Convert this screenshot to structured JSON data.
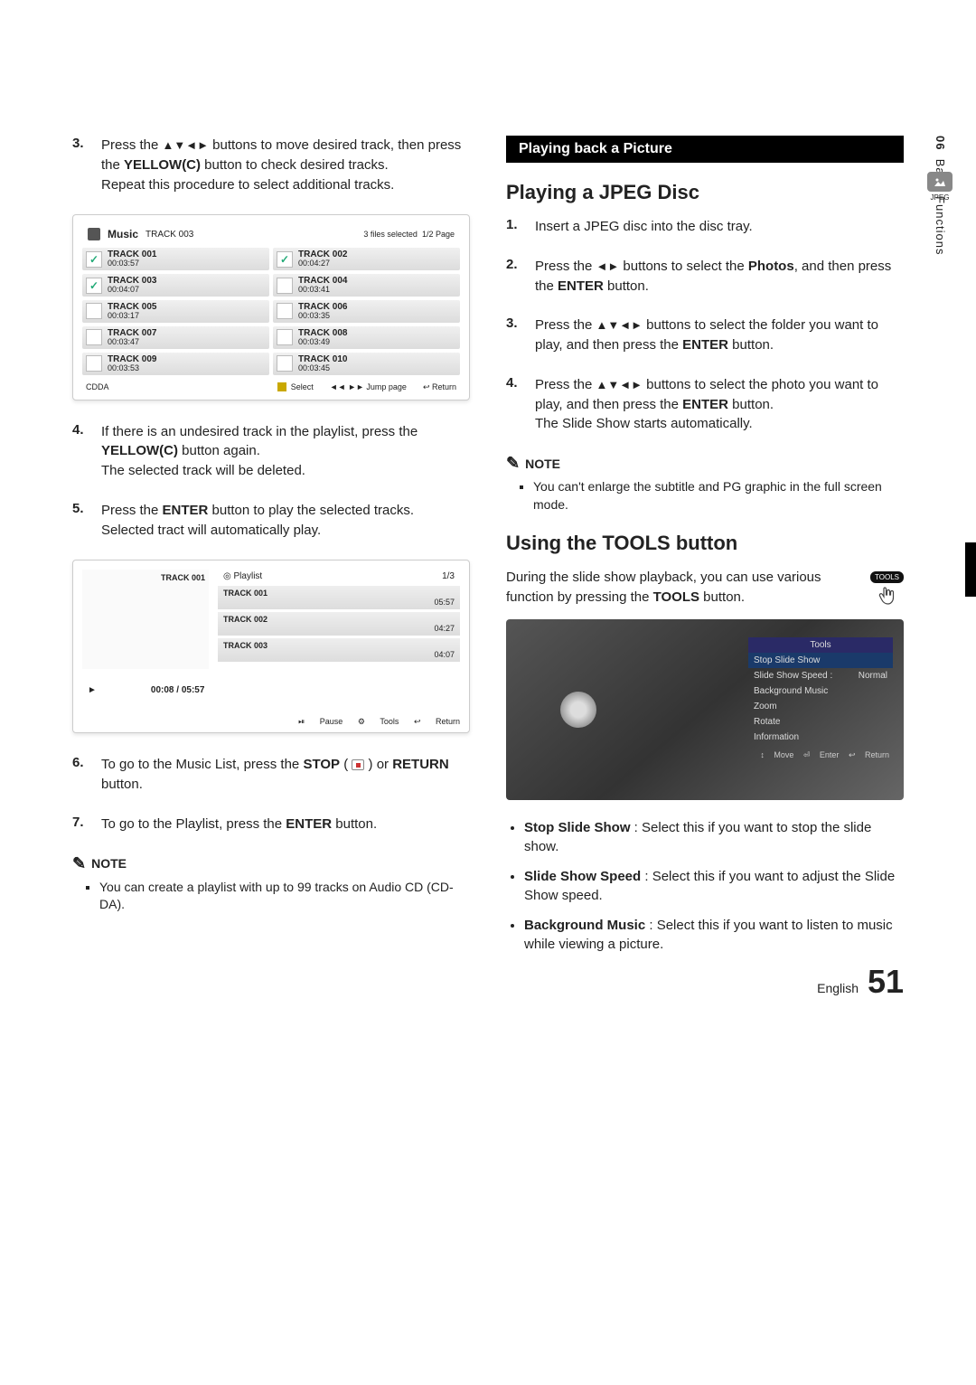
{
  "side": {
    "chapter_num": "06",
    "chapter": "Basic Functions",
    "jpeg": "JPEG"
  },
  "left": {
    "step3": {
      "num": "3.",
      "p1a": "Press the ",
      "p1b": " buttons to move desired track, then press the ",
      "p1c": "YELLOW(C)",
      "p1d": " button to check desired tracks.",
      "p2": "Repeat this procedure to select additional tracks."
    },
    "music": {
      "title": "Music",
      "sub": "TRACK 003",
      "right1": "3 files selected",
      "right2": "1/2 Page",
      "tracks": [
        {
          "n": "TRACK 001",
          "t": "00:03:57",
          "chk": true
        },
        {
          "n": "TRACK 002",
          "t": "00:04:27",
          "chk": true
        },
        {
          "n": "TRACK 003",
          "t": "00:04:07",
          "chk": true
        },
        {
          "n": "TRACK 004",
          "t": "00:03:41",
          "chk": false
        },
        {
          "n": "TRACK 005",
          "t": "00:03:17",
          "chk": false
        },
        {
          "n": "TRACK 006",
          "t": "00:03:35",
          "chk": false
        },
        {
          "n": "TRACK 007",
          "t": "00:03:47",
          "chk": false
        },
        {
          "n": "TRACK 008",
          "t": "00:03:49",
          "chk": false
        },
        {
          "n": "TRACK 009",
          "t": "00:03:53",
          "chk": false
        },
        {
          "n": "TRACK 010",
          "t": "00:03:45",
          "chk": false
        }
      ],
      "ft": {
        "cdda": "CDDA",
        "select": "Select",
        "jump": "Jump page",
        "ret": "Return"
      }
    },
    "step4": {
      "num": "4.",
      "p1a": "If there is an undesired track in the playlist, press the ",
      "p1b": "YELLOW(C)",
      "p1c": " button again.",
      "p2": "The selected track will be deleted."
    },
    "step5": {
      "num": "5.",
      "p1a": "Press the ",
      "p1b": "ENTER",
      "p1c": " button to play the selected tracks.",
      "p2": "Selected tract will automatically play."
    },
    "player": {
      "album": "TRACK 001",
      "pl": "Playlist",
      "count": "1/3",
      "rows": [
        {
          "n": "TRACK 001",
          "t": "05:57"
        },
        {
          "n": "TRACK 002",
          "t": "04:27"
        },
        {
          "n": "TRACK 003",
          "t": "04:07"
        }
      ],
      "time": "00:08 / 05:57",
      "ft": {
        "pause": "Pause",
        "tools": "Tools",
        "ret": "Return"
      }
    },
    "step6": {
      "num": "6.",
      "p1a": "To go to the Music List, press the ",
      "p1b": "STOP",
      "p1c": " ( ",
      "p1d": " ) or ",
      "p1e": "RETURN",
      "p1f": " button."
    },
    "step7": {
      "num": "7.",
      "p1a": "To go to the Playlist, press the ",
      "p1b": "ENTER",
      "p1c": " button."
    },
    "note_hd": "NOTE",
    "note1": "You can create a playlist with up to 99 tracks on Audio CD (CD-DA)."
  },
  "right": {
    "sec_title": "Playing back a Picture",
    "h_jpeg": "Playing a JPEG Disc",
    "s1": {
      "num": "1.",
      "t": "Insert a JPEG disc into the disc tray."
    },
    "s2": {
      "num": "2.",
      "a": "Press the ",
      "b": " buttons to select the ",
      "c": "Photos",
      "d": ", and then press the ",
      "e": "ENTER",
      "f": " button."
    },
    "s3": {
      "num": "3.",
      "a": "Press the ",
      "b": " buttons to select the folder you want to play, and then press the ",
      "c": "ENTER",
      "d": " button."
    },
    "s4": {
      "num": "4.",
      "a": "Press the ",
      "b": " buttons to select the photo you want to play, and then press the ",
      "c": "ENTER",
      "d": " button.",
      "e": "The Slide Show starts automatically."
    },
    "note_hd": "NOTE",
    "note1": "You can't enlarge the subtitle and PG graphic in the full screen mode.",
    "h_tools": "Using the TOOLS button",
    "tools_para_a": "During the slide show playback, you can use various function by pressing the ",
    "tools_para_b": "TOOLS",
    "tools_para_c": " button.",
    "tools_btn": "TOOLS",
    "tools_menu": {
      "title": "Tools",
      "items": [
        {
          "label": "Stop Slide Show",
          "val": ""
        },
        {
          "label": "Slide Show Speed :",
          "val": "Normal"
        },
        {
          "label": "Background Music",
          "val": ""
        },
        {
          "label": "Zoom",
          "val": ""
        },
        {
          "label": "Rotate",
          "val": ""
        },
        {
          "label": "Information",
          "val": ""
        }
      ],
      "ft": {
        "move": "Move",
        "enter": "Enter",
        "ret": "Return"
      }
    },
    "bullets": [
      {
        "b": "Stop Slide Show",
        "t": " : Select this if you want to stop the slide show."
      },
      {
        "b": "Slide Show Speed",
        "t": " : Select this if you want to adjust the Slide Show speed."
      },
      {
        "b": "Background Music",
        "t": " : Select this if you want to listen to music while viewing a picture."
      }
    ]
  },
  "footer": {
    "lang": "English",
    "page": "51"
  },
  "arrows": {
    "udlr": "▲▼◄►",
    "lr": "◄►"
  }
}
